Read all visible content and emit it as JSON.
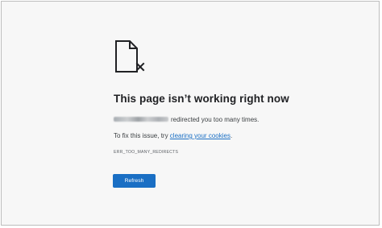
{
  "error": {
    "icon": "broken-document-icon",
    "title": "This page isn’t working right now",
    "message": "redirected you too many times.",
    "fix_prefix": "To fix this issue, try ",
    "fix_link": "clearing your cookies",
    "fix_suffix": ".",
    "code": "ERR_TOO_MANY_REDIRECTS"
  },
  "actions": {
    "refresh_label": "Refresh"
  },
  "colors": {
    "accent": "#1a6fc4",
    "background": "#f7f7f7",
    "text": "#202124"
  }
}
